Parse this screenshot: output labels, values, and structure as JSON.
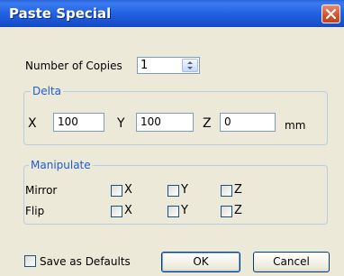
{
  "window": {
    "title": "Paste Special"
  },
  "copies": {
    "label": "Number of Copies",
    "value": "1"
  },
  "delta": {
    "title": "Delta",
    "x_label": "X",
    "x_value": "100",
    "y_label": "Y",
    "y_value": "100",
    "z_label": "Z",
    "z_value": "0",
    "unit": "mm"
  },
  "manipulate": {
    "title": "Manipulate",
    "mirror_label": "Mirror",
    "flip_label": "Flip",
    "axis_x": "X",
    "axis_y": "Y",
    "axis_z": "Z"
  },
  "footer": {
    "save_defaults_label": "Save as Defaults",
    "ok_label": "OK",
    "cancel_label": "Cancel"
  }
}
